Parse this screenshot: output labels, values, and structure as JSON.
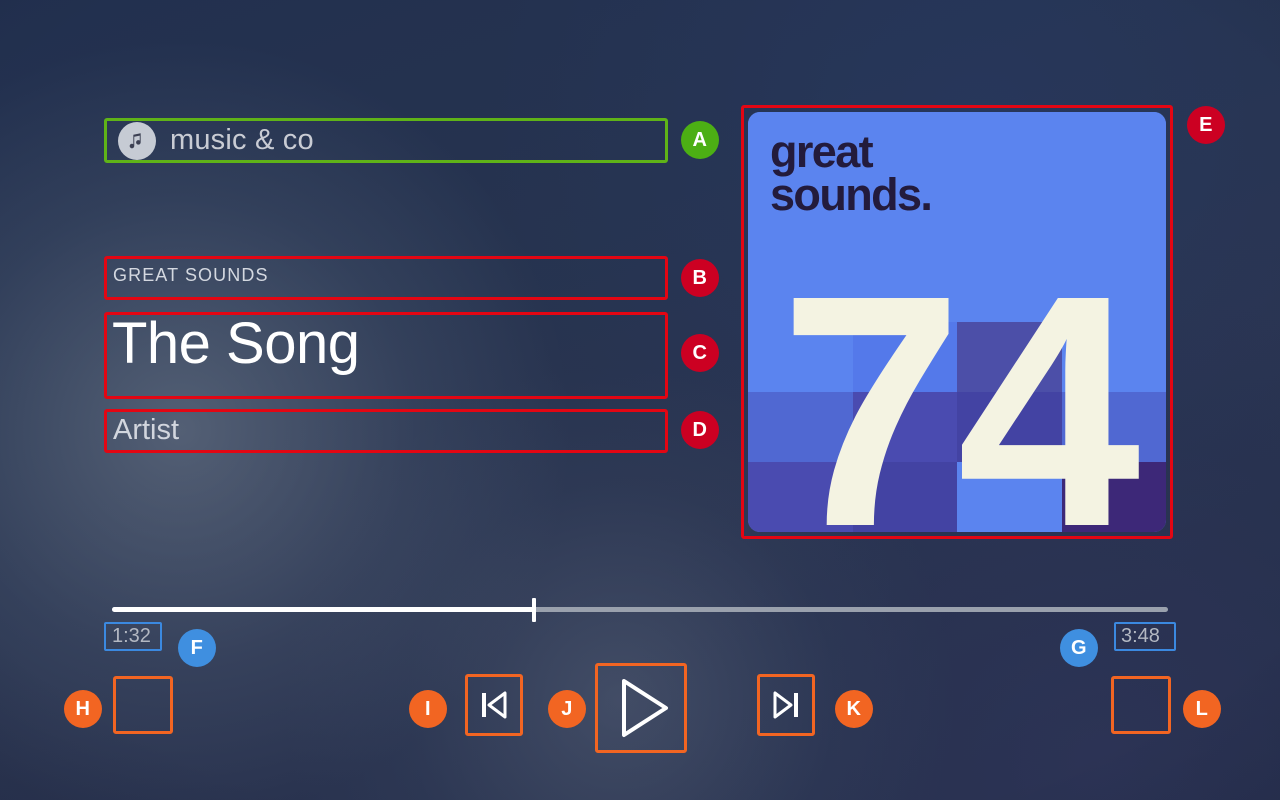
{
  "app": {
    "search": {
      "value": "music & co",
      "avatar_icon": "music-note-icon"
    }
  },
  "track": {
    "album": "GREAT SOUNDS",
    "title": "The Song",
    "artist": "Artist"
  },
  "album_art": {
    "brand_line1": "great",
    "brand_line2": "sounds.",
    "number": "74",
    "colors": {
      "base": "#5b84ef",
      "light": "#6f92f2",
      "mid": "#4f61c4",
      "dark": "#4443a0",
      "darkest": "#3d2878",
      "number": "#f4f3e2",
      "brand_text": "#231b3c"
    },
    "tiles": [
      "#5b84ef",
      "#5b84ef",
      "#5b84ef",
      "#5b84ef",
      "#5b84ef",
      "#5b84ef",
      "#5b84ef",
      "#5b84ef",
      "#5b84ef",
      "#5b84ef",
      "#5b84ef",
      "#5b84ef",
      "#5b84ef",
      "#5479ea",
      "#4c4fa8",
      "#5b84ef",
      "#5068d2",
      "#4a4bb0",
      "#4343a3",
      "#5068d2",
      "#4a4bb0",
      "#4343a3",
      "#5b84ef",
      "#3d2878"
    ]
  },
  "player": {
    "time_current": "1:32",
    "time_total": "3:48",
    "progress_percent": 40,
    "controls": {
      "shuffle": "",
      "previous": "previous-track-icon",
      "play": "play-icon",
      "next": "next-track-icon",
      "repeat": ""
    }
  },
  "annotations": {
    "colors": {
      "red": "#e30613",
      "green": "#5fb318",
      "orange": "#f26522",
      "blue": "#3b89e0",
      "badge_red": "#cc0022",
      "badge_green": "#4caf14",
      "badge_blue": "#3f8fe0",
      "badge_orange": "#f26522"
    },
    "markers": [
      {
        "id": "A",
        "target": "search-field"
      },
      {
        "id": "B",
        "target": "album-label"
      },
      {
        "id": "C",
        "target": "track-title"
      },
      {
        "id": "D",
        "target": "artist-name"
      },
      {
        "id": "E",
        "target": "album-art"
      },
      {
        "id": "F",
        "target": "current-time"
      },
      {
        "id": "G",
        "target": "total-time"
      },
      {
        "id": "H",
        "target": "shuffle-button"
      },
      {
        "id": "I",
        "target": "previous-button"
      },
      {
        "id": "J",
        "target": "play-button"
      },
      {
        "id": "K",
        "target": "next-button"
      },
      {
        "id": "L",
        "target": "repeat-button"
      }
    ]
  }
}
